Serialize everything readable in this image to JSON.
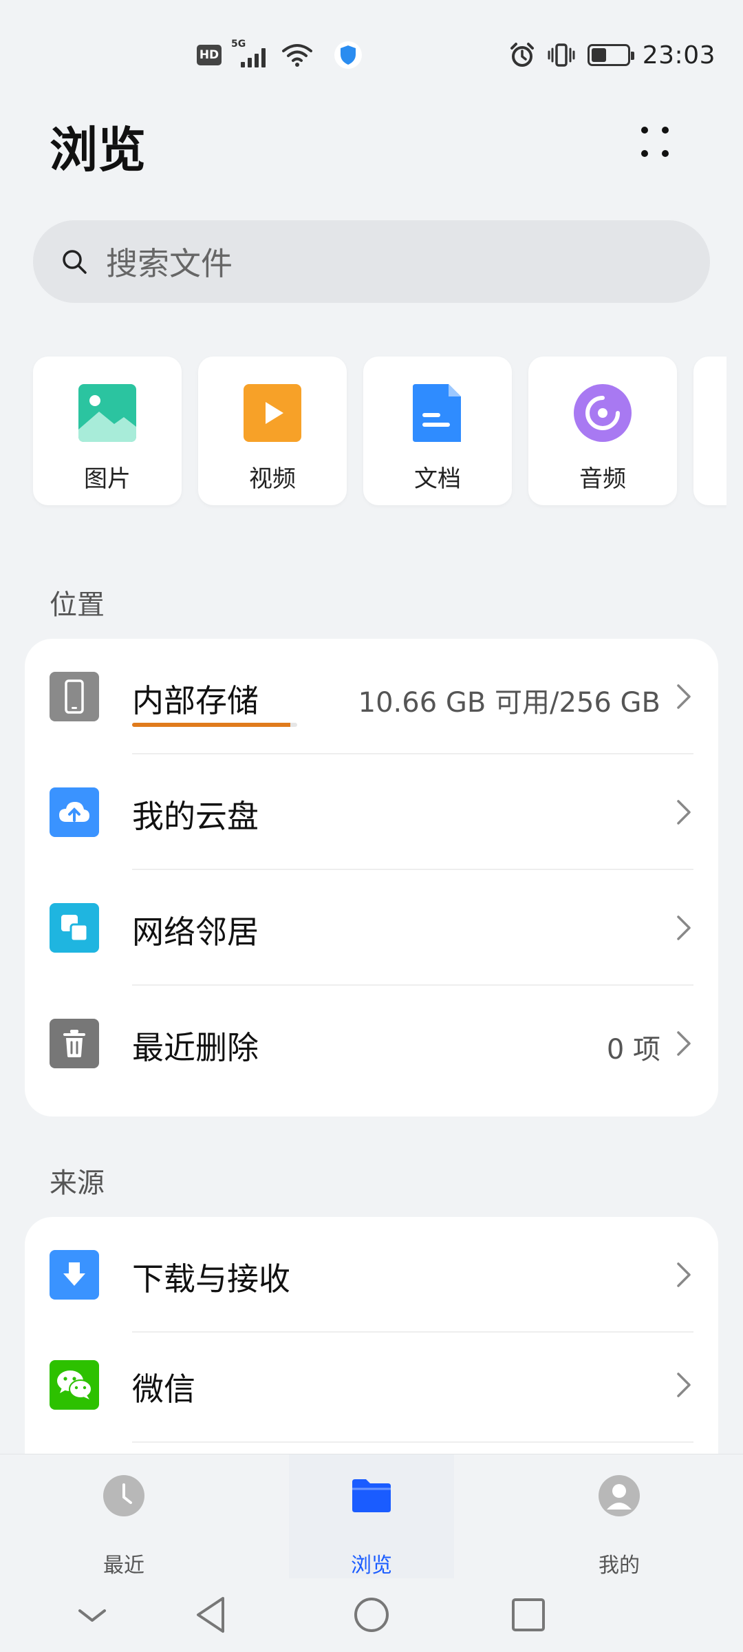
{
  "status_bar": {
    "hd": "HD",
    "network": "5G",
    "time": "23:03"
  },
  "header": {
    "title": "浏览",
    "more_icon": "more-dots-icon"
  },
  "search": {
    "placeholder": "搜索文件",
    "icon": "search-icon"
  },
  "categories": [
    {
      "label": "图片",
      "icon": "image-icon",
      "color": "#2bc4a0"
    },
    {
      "label": "视频",
      "icon": "video-icon",
      "color": "#f7a128"
    },
    {
      "label": "文档",
      "icon": "document-icon",
      "color": "#2f8cff"
    },
    {
      "label": "音频",
      "icon": "audio-icon",
      "color": "#a879f2"
    }
  ],
  "location": {
    "title": "位置",
    "items": [
      {
        "label": "内部存储",
        "value": "10.66 GB 可用/256 GB",
        "icon": "phone-icon",
        "color": "#8a8a8a",
        "usage_fraction": 0.958
      },
      {
        "label": "我的云盘",
        "value": "",
        "icon": "cloud-icon",
        "color": "#3a93ff"
      },
      {
        "label": "网络邻居",
        "value": "",
        "icon": "network-icon",
        "color": "#1fb5e0"
      },
      {
        "label": "最近删除",
        "value": "0 项",
        "icon": "trash-icon",
        "color": "#777777"
      }
    ]
  },
  "source": {
    "title": "来源",
    "items": [
      {
        "label": "下载与接收",
        "icon": "download-icon",
        "color": "#3a93ff"
      },
      {
        "label": "微信",
        "icon": "wechat-icon",
        "color": "#2dc100"
      }
    ]
  },
  "bottom_nav": [
    {
      "label": "最近",
      "icon": "clock-icon",
      "active": false
    },
    {
      "label": "浏览",
      "icon": "folder-icon",
      "active": true
    },
    {
      "label": "我的",
      "icon": "profile-icon",
      "active": false
    }
  ],
  "system_nav": {
    "icons": [
      "hide-keyboard-icon",
      "back-icon",
      "home-icon",
      "recents-icon"
    ]
  }
}
